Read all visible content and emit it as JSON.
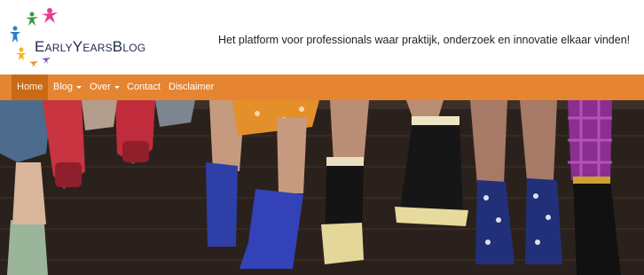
{
  "site": {
    "logo_text": "EarlyYearsBlog",
    "tagline": "Het platform voor professionals waar praktijk, onderzoek en innovatie elkaar vinden!"
  },
  "nav": {
    "items": [
      {
        "label": "Home",
        "active": true,
        "has_dropdown": false
      },
      {
        "label": "Blog",
        "active": false,
        "has_dropdown": true
      },
      {
        "label": "Over",
        "active": false,
        "has_dropdown": true
      },
      {
        "label": "Contact",
        "active": false,
        "has_dropdown": false
      },
      {
        "label": "Disclaimer",
        "active": false,
        "has_dropdown": false
      }
    ]
  },
  "colors": {
    "nav_bg": "#e58431",
    "nav_active_bg": "#c96a16",
    "logo_figures": [
      "#e23f8f",
      "#3a9a3c",
      "#2f7fc5",
      "#f2b51d",
      "#7d4fb3",
      "#e88a2a"
    ]
  },
  "hero": {
    "image": "children-in-rain-boots-sitting-on-brick-wall"
  }
}
